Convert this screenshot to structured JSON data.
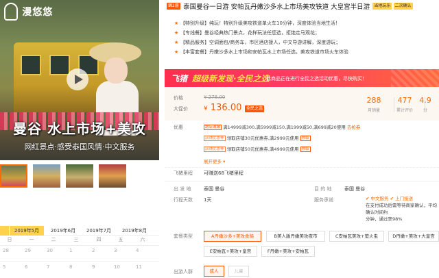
{
  "gallery": {
    "logo_text": "漫悠悠",
    "logo_sub": "",
    "headline": "曼谷 水上市场+美攻",
    "subline": "网红景点·感受泰国风情·中文服务",
    "play_icon": "play-icon",
    "thumbs": [
      {
        "label": ""
      },
      {
        "label": ""
      },
      {
        "label": ""
      },
      {
        "label": ""
      }
    ]
  },
  "calendar": {
    "tabs": [
      "2019年5月",
      "2019年6月",
      "2019年7月",
      "2019年8月"
    ],
    "weekdays": [
      "日",
      "一",
      "二",
      "三",
      "四",
      "五",
      "六"
    ],
    "dates": [
      "28",
      "29",
      "30",
      "1",
      "2",
      "3",
      "4",
      "5",
      "6",
      "7",
      "8",
      "9",
      "10",
      "11"
    ]
  },
  "title": {
    "badge_left": "錦2層",
    "text": "泰国曼谷一日游 安帕瓦丹嫩沙多水上市场美攻铁道 大皇宫半日游",
    "badge_right1": "当地玩乐",
    "badge_right2": "二次确认"
  },
  "features": [
    "【特别升级】纯玩！特别升级美攻铁道单火车10分钟，深度体验当地生活！",
    "【专线餐】曼谷经典热门景点，花样玩法任您选，拒绝走马观花；",
    "【精品服务】空调面包/商务车，市区酒店接人，中文导游讲解，深度游玩；",
    "【丰富套餐】丹嫩沙多水上市场和安帕瓦水上市场任选，美攻铁道市场火车体验"
  ],
  "banner": {
    "logo": "飞猪",
    "slogan": "超级新发现·全民之选",
    "note": "此商品正在进行全民之选活动优惠，尽快购买！"
  },
  "price": {
    "label_price": "价格",
    "old": "¥ 278.00",
    "label_sale": "大促价",
    "new_symbol": "¥",
    "new_value": "136.00",
    "sale_tag": "全民之选",
    "stats": [
      {
        "num": "288",
        "cap": "月销量"
      },
      {
        "num": "477",
        "cap": "累计评价"
      },
      {
        "num": "4.9",
        "cap": "分"
      }
    ]
  },
  "promo": {
    "label": "优惠",
    "rows": [
      {
        "tag": "跨店满减",
        "text": "满14999减300,满5999减150,满1999减50,满699减20使用",
        "link": "去抢券"
      },
      {
        "tag": "店铺优惠券",
        "text": "领取店铺30元优惠券,满2999元使用",
        "link": "领取"
      },
      {
        "tag": "店铺优惠券",
        "text": "领取店铺50元优惠券,满4999元使用",
        "link": "领取"
      }
    ],
    "expand": "展开更多",
    "fly_label": "飞猪里程",
    "fly_text": "可赚送68飞猪里程"
  },
  "info": {
    "depart_k": "出 发 地",
    "depart_v": "泰国    曼谷",
    "dest_k": "目 的 地",
    "dest_v": "泰国    曼谷",
    "days_k": "行程天数",
    "days_v": "1天",
    "svc_k": "服务承诺",
    "svc_lines": [
      "✔ 中文服务    ✔ 上门接送",
      "在支付成功后需等待商家确认，平均确认时间约",
      "分钟，通过率98%"
    ]
  },
  "packages": {
    "label": "套餐类型",
    "options": [
      "A丹嫩沙多+美攻食船",
      "B美人版丹嫩美攻夜市",
      "C安帕瓦美攻+萤火虫",
      "D丹嫩+美攻+大皇宫",
      "E安帕瓦+美攻+皇宫",
      "F丹嫩+美攻+安帕瓦"
    ],
    "crowd_label": "出游人群",
    "crowd": [
      "成人",
      "儿童"
    ]
  }
}
